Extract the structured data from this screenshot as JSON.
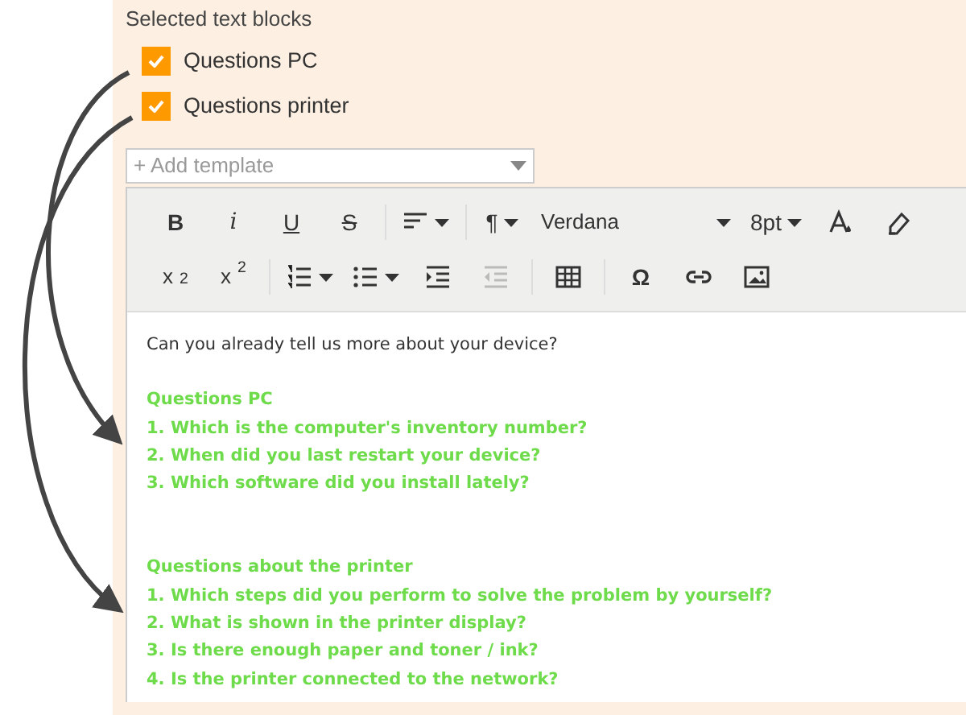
{
  "section_title": "Selected text blocks",
  "text_blocks": [
    {
      "label": "Questions PC",
      "checked": true
    },
    {
      "label": "Questions printer",
      "checked": true
    }
  ],
  "template_select": {
    "placeholder": "+ Add template"
  },
  "toolbar": {
    "rows": [
      [
        {
          "kind": "bold",
          "label": "B"
        },
        {
          "kind": "italic",
          "label": "i"
        },
        {
          "kind": "underline",
          "label": "U"
        },
        {
          "kind": "strike",
          "label": "S"
        },
        {
          "kind": "align"
        },
        {
          "kind": "paragraph",
          "label": "¶"
        },
        {
          "kind": "font",
          "label": "Verdana"
        },
        {
          "kind": "size",
          "label": "8pt"
        },
        {
          "kind": "color"
        },
        {
          "kind": "eraser"
        }
      ],
      [
        {
          "kind": "script",
          "label": "x$_{2}$"
        },
        {
          "kind": "script",
          "label": "x$^{2}$"
        },
        {
          "kind": "ol"
        },
        {
          "kind": "ul"
        },
        {
          "kind": "indent",
          "disabled": false
        },
        {
          "kind": "outdent",
          "disabled": true
        },
        {
          "kind": "table"
        },
        {
          "kind": "symbol",
          "label": "Ω"
        },
        {
          "kind": "link"
        },
        {
          "kind": "image"
        }
      ]
    ]
  },
  "editor": {
    "intro": "Can you already tell us more about your device?",
    "blocks": [
      {
        "heading": "Questions PC",
        "lines": [
          "1. Which is the computer's inventory number?",
          "2. When did you last restart your device?",
          "3. Which software did you install lately?"
        ]
      },
      {
        "heading": "Questions about the printer",
        "lines": [
          "1. Which steps did you perform to solve the problem by yourself?",
          "2. What is shown in the printer display?",
          "3. Is there enough paper and toner / ink?",
          "4. Is the printer connected to the network?"
        ]
      }
    ]
  }
}
